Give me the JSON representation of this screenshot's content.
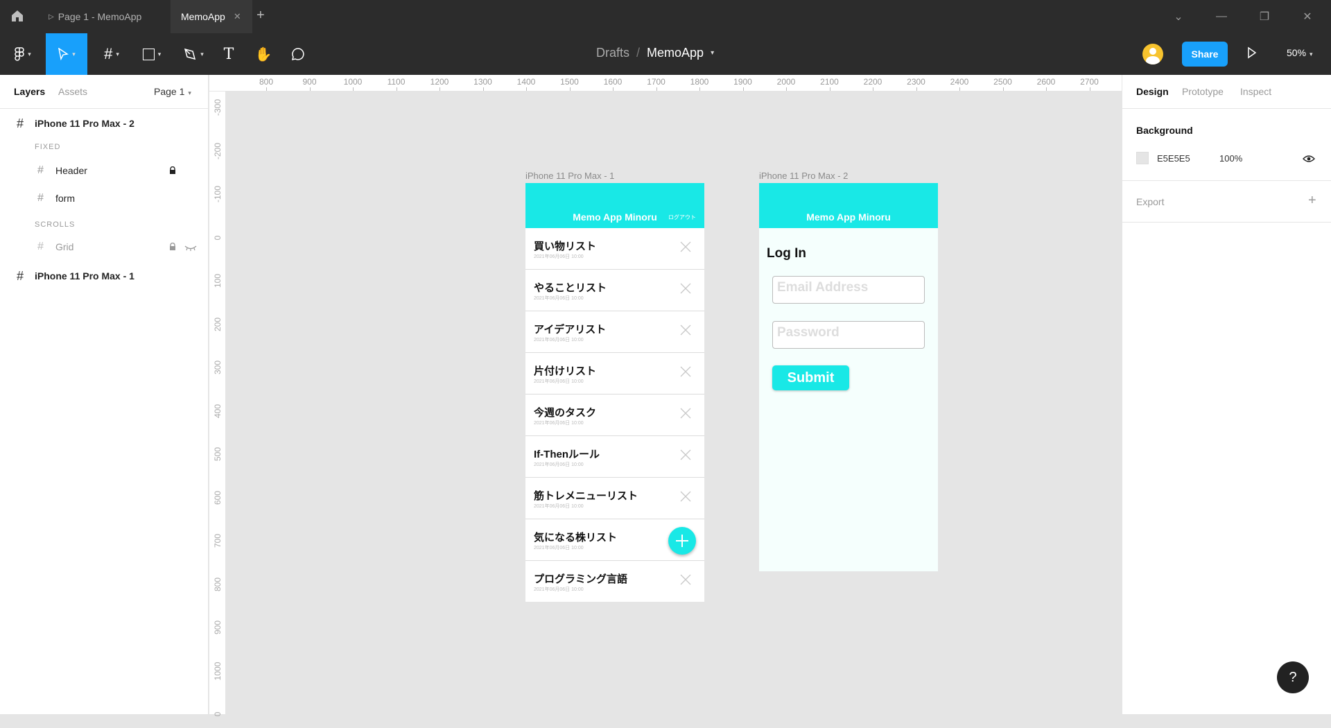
{
  "window": {
    "tabs": [
      {
        "label": "Page 1 - MemoApp"
      },
      {
        "label": "MemoApp"
      }
    ]
  },
  "toolbar": {
    "breadcrumb_parent": "Drafts",
    "breadcrumb_sep": "/",
    "file_name": "MemoApp",
    "share_label": "Share",
    "zoom": "50%"
  },
  "left_panel": {
    "tabs": [
      "Layers",
      "Assets"
    ],
    "page_selector": "Page 1",
    "layers": {
      "frame2": "iPhone 11 Pro Max - 2",
      "fixed_label": "FIXED",
      "header": "Header",
      "form": "form",
      "scrolls_label": "SCROLLS",
      "grid": "Grid",
      "frame1": "iPhone 11 Pro Max - 1"
    }
  },
  "rulers": {
    "top": [
      "800",
      "900",
      "1000",
      "1100",
      "1200",
      "1300",
      "1400",
      "1500",
      "1600",
      "1700",
      "1800",
      "1900",
      "2000",
      "2100",
      "2200",
      "2300",
      "2400",
      "2500",
      "2600",
      "2700"
    ],
    "left": [
      "-300",
      "-200",
      "-100",
      "0",
      "100",
      "200",
      "300",
      "400",
      "500",
      "600",
      "700",
      "800",
      "900",
      "1000",
      "0"
    ]
  },
  "canvas": {
    "frame1_label": "iPhone 11 Pro Max - 1",
    "frame2_label": "iPhone 11 Pro Max - 2",
    "app_title": "Memo App Minoru",
    "logout": "ログアウト",
    "memos": [
      {
        "title": "買い物リスト",
        "date": "2021年06月06日 10:00"
      },
      {
        "title": "やることリスト",
        "date": "2021年06月06日 10:00"
      },
      {
        "title": "アイデアリスト",
        "date": "2021年06月06日 10:00"
      },
      {
        "title": "片付けリスト",
        "date": "2021年06月06日 10:00"
      },
      {
        "title": "今週のタスク",
        "date": "2021年06月06日 10:00"
      },
      {
        "title": "If-Thenルール",
        "date": "2021年06月06日 10:00"
      },
      {
        "title": "筋トレメニューリスト",
        "date": "2021年06月06日 10:00"
      },
      {
        "title": "気になる株リスト",
        "date": "2021年06月06日 10:00"
      },
      {
        "title": "プログラミング言語",
        "date": "2021年06月06日 10:00"
      }
    ],
    "login_title": "Log In",
    "email_placeholder": "Email Address",
    "password_placeholder": "Password",
    "submit_label": "Submit",
    "accent_color": "#19e8e6"
  },
  "right_panel": {
    "tabs": [
      "Design",
      "Prototype",
      "Inspect"
    ],
    "background_label": "Background",
    "bg_hex": "E5E5E5",
    "bg_opacity": "100%",
    "export_label": "Export"
  },
  "help_label": "?"
}
